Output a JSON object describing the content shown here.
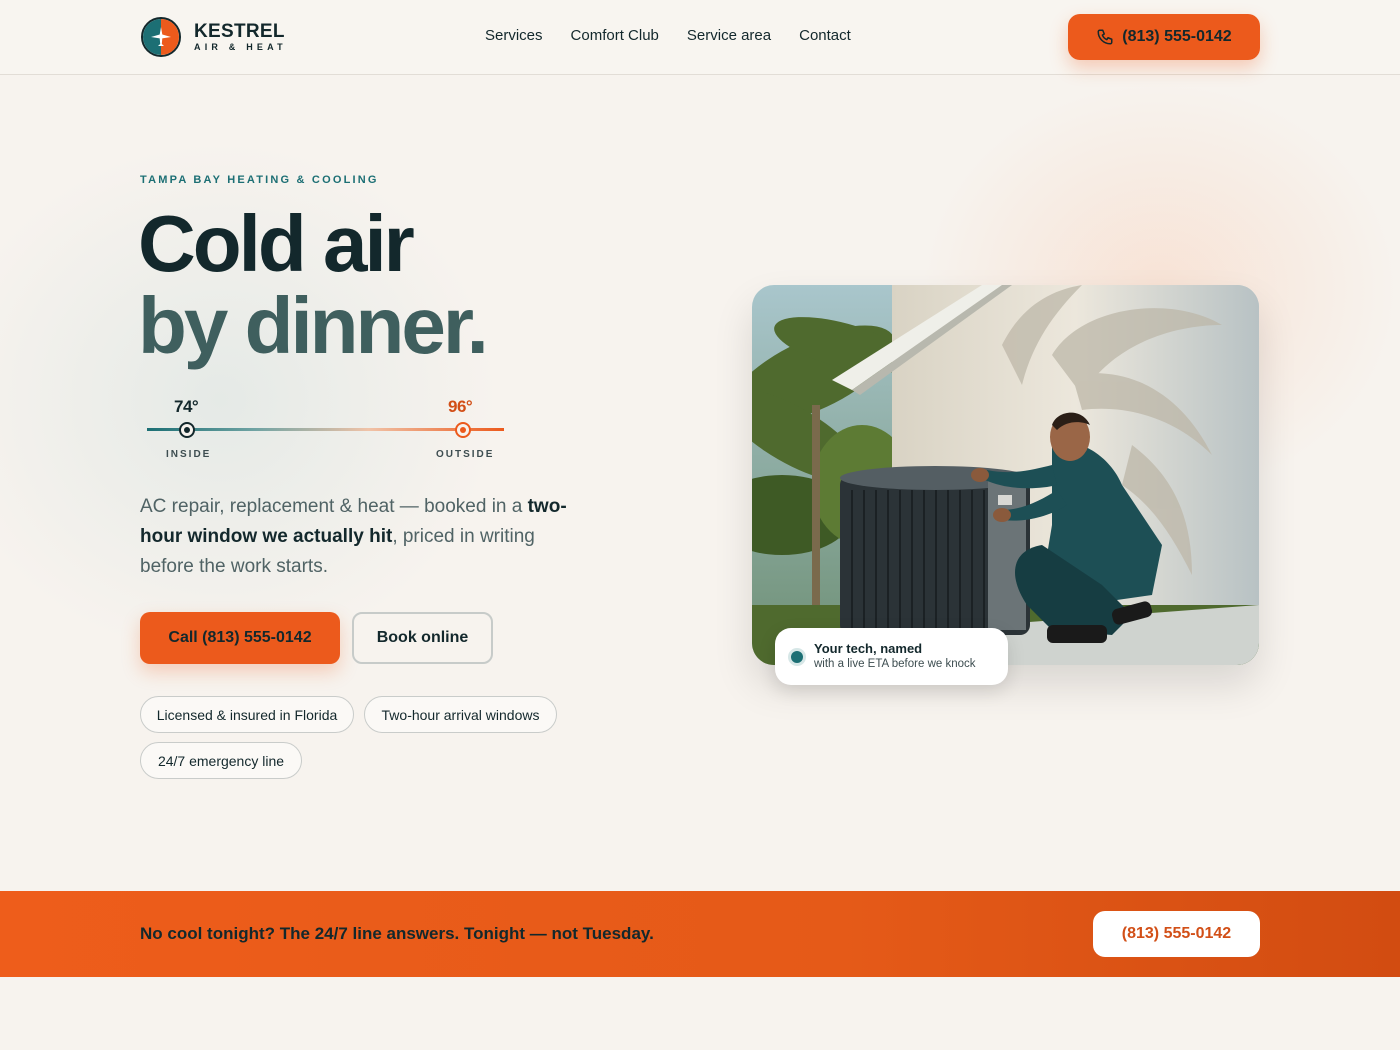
{
  "brand": {
    "name": "KESTREL",
    "tagline": "AIR & HEAT",
    "colors": {
      "primary": "#ec5a1c",
      "teal": "#1c6f74",
      "ink": "#13282c",
      "background": "#f7f3ee"
    }
  },
  "nav": {
    "items": [
      {
        "label": "Services"
      },
      {
        "label": "Comfort Club"
      },
      {
        "label": "Service area"
      },
      {
        "label": "Contact"
      }
    ],
    "phone_button": {
      "label": "(813) 555-0142",
      "icon": "phone-icon"
    }
  },
  "hero": {
    "eyebrow": "TAMPA BAY HEATING & COOLING",
    "headline_line1": "Cold air",
    "headline_line2": "by dinner.",
    "temperature": {
      "inside_value": "74°",
      "inside_label": "INSIDE",
      "outside_value": "96°",
      "outside_label": "OUTSIDE"
    },
    "lead_part1": "AC repair, replacement & heat — booked in a ",
    "lead_bold": "two-hour window we actually hit",
    "lead_part2": ", priced in writing before the work starts.",
    "cta_call": "Call (813) 555-0142",
    "cta_book": "Book online",
    "badges": [
      "Licensed & insured in Florida",
      "Two-hour arrival windows",
      "24/7 emergency line"
    ]
  },
  "photo_card": {
    "title": "Your tech, named",
    "subtitle": "with a live ETA before we knock"
  },
  "band": {
    "text": "No cool tonight? The 24/7 line answers. Tonight — not Tuesday.",
    "button": "(813) 555-0142"
  }
}
